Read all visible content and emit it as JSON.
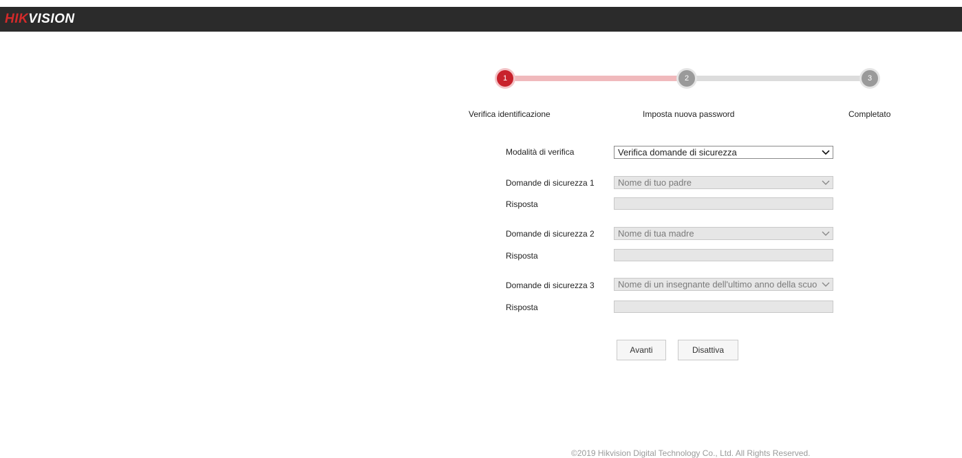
{
  "header": {
    "logo_part1": "HIK",
    "logo_part2": "VISION"
  },
  "stepper": {
    "steps": [
      {
        "number": "1",
        "label": "Verifica identificazione",
        "state": "active"
      },
      {
        "number": "2",
        "label": "Imposta nuova password",
        "state": "pending"
      },
      {
        "number": "3",
        "label": "Completato",
        "state": "pending"
      }
    ]
  },
  "form": {
    "mode_label": "Modalità di verifica",
    "mode_value": "Verifica domande di sicurezza",
    "questions": [
      {
        "label": "Domande di sicurezza 1",
        "value": "Nome di tuo padre",
        "answer_label": "Risposta",
        "answer_value": ""
      },
      {
        "label": "Domande di sicurezza 2",
        "value": "Nome di tua madre",
        "answer_label": "Risposta",
        "answer_value": ""
      },
      {
        "label": "Domande di sicurezza 3",
        "value": "Nome di un insegnante dell'ultimo anno della scuola",
        "answer_label": "Risposta",
        "answer_value": ""
      }
    ]
  },
  "buttons": {
    "next": "Avanti",
    "disable": "Disattiva"
  },
  "footer": {
    "copyright": "©2019 Hikvision Digital Technology Co., Ltd. All Rights Reserved."
  },
  "colors": {
    "header_bg": "#2b2b2b",
    "brand_red": "#d42a2a",
    "step_active": "#c8222c",
    "step_done_track": "#f0b9bc",
    "step_pending": "#9a9a9a"
  },
  "icons": {
    "dropdown": "chevron-down-icon"
  }
}
